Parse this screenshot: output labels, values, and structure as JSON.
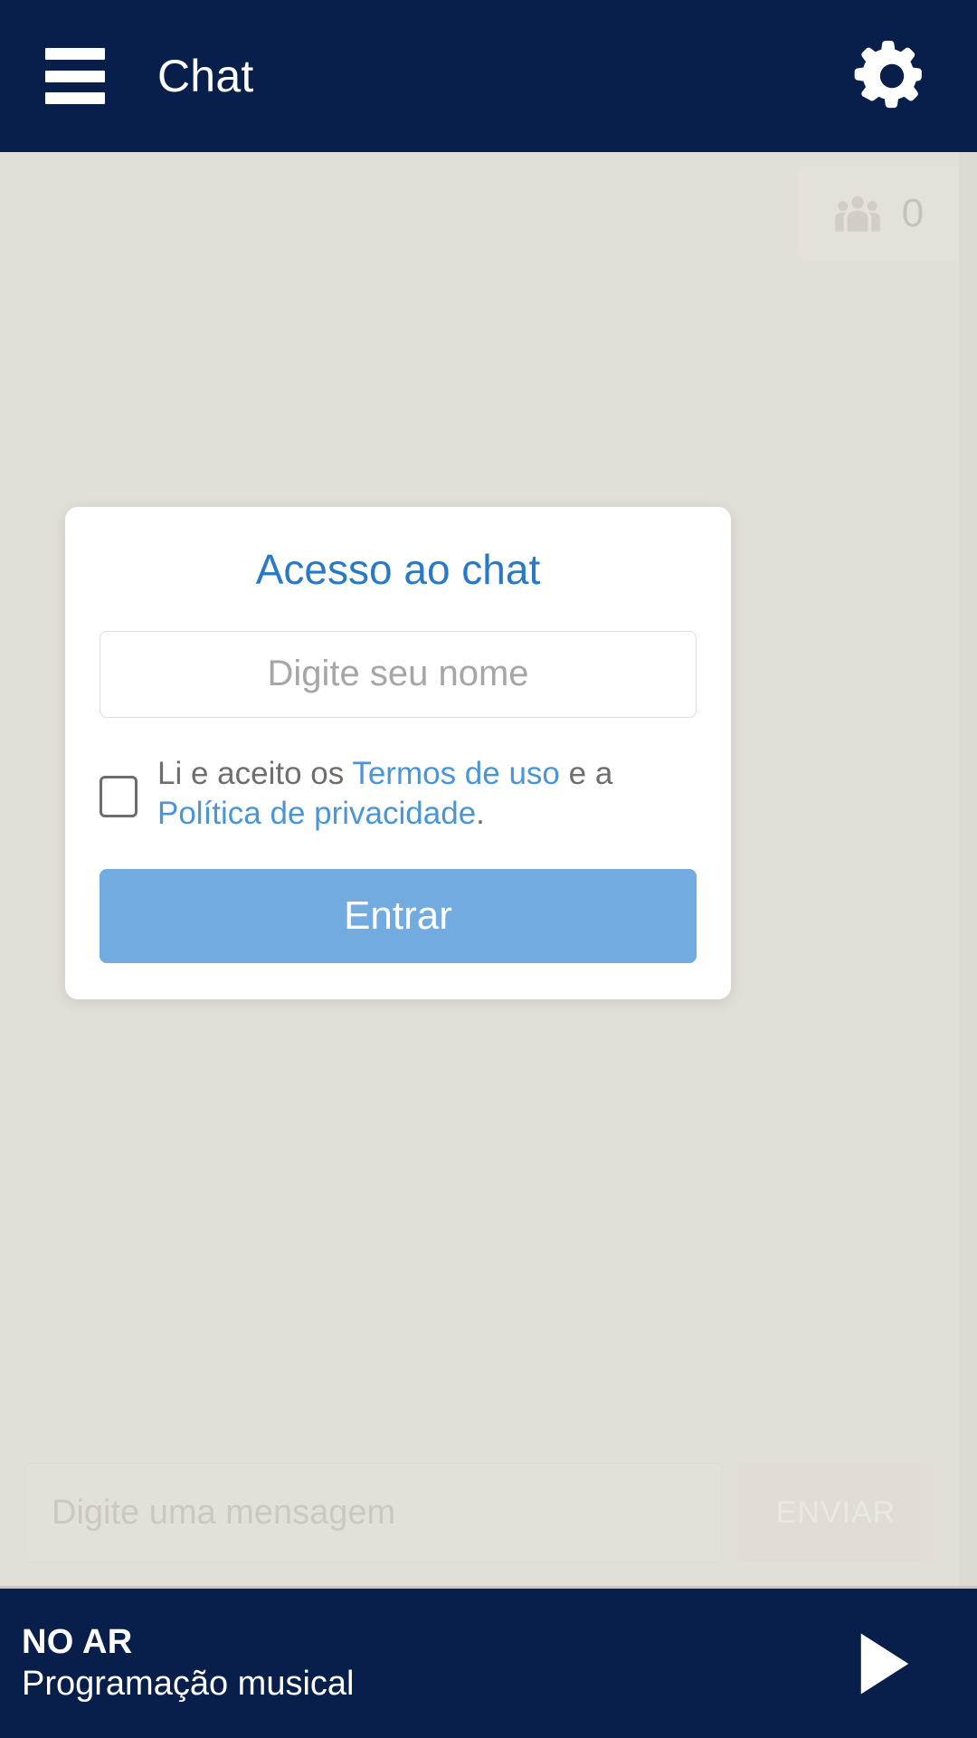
{
  "header": {
    "title": "Chat",
    "menu_icon": "hamburger-menu-icon",
    "settings_icon": "gear-icon"
  },
  "chat": {
    "users_badge": {
      "icon": "people-group-icon",
      "count": "0"
    },
    "composer": {
      "placeholder": "Digite uma mensagem",
      "value": "",
      "send_label": "ENVIAR"
    }
  },
  "login_modal": {
    "title": "Acesso ao chat",
    "name_input": {
      "placeholder": "Digite seu nome",
      "value": ""
    },
    "terms": {
      "prefix": "Li e aceito os ",
      "terms_link": "Termos de uso",
      "middle": " e a ",
      "privacy_link": "Política de privacidade",
      "suffix": "."
    },
    "submit_label": "Entrar"
  },
  "player": {
    "status": "NO AR",
    "program": "Programação musical",
    "play_icon": "play-triangle-icon"
  },
  "colors": {
    "navy": "#081f4b",
    "page_background": "#ddd9d3",
    "card_background": "#ffffff",
    "title_blue": "#2a79c4",
    "link_blue": "#4a95d6",
    "button_blue": "#72abe0",
    "placeholder_gray": "#a6a6a6",
    "terms_text_gray": "#6e6e6e"
  }
}
